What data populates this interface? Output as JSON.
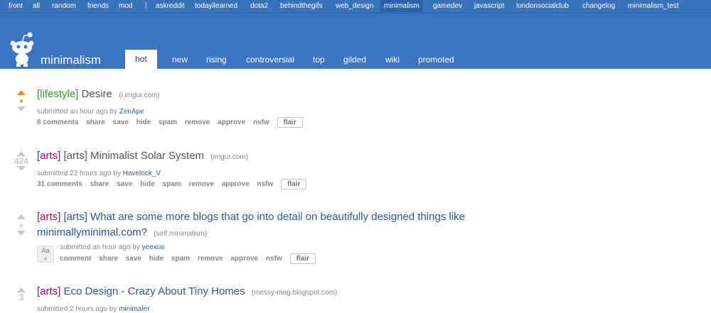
{
  "srbar": {
    "items": [
      "front",
      "all",
      "random",
      "friends",
      "mod",
      "|",
      "askreddit",
      "todayilearned",
      "dota2",
      "behindthegifs",
      "web_design",
      "minimalism",
      "gamedev",
      "javascript",
      "londonsocialclub",
      "changelog",
      "minimalism_test"
    ],
    "active": "minimalism"
  },
  "header": {
    "subreddit": "minimalism",
    "tabs": [
      "hot",
      "new",
      "rising",
      "controversial",
      "top",
      "gilded",
      "wiki",
      "promoted"
    ],
    "selected_tab": "hot"
  },
  "posts": [
    {
      "score": "",
      "flair": "[lifestyle]",
      "title": "Desire",
      "domain": "(i.imgur.com)",
      "submitted": "submitted an hour ago by",
      "author": "ZenApe",
      "buttons": [
        "8 comments",
        "share",
        "save",
        "hide",
        "spam",
        "remove",
        "approve",
        "nsfw"
      ],
      "flair_button": "flair"
    },
    {
      "score": "424",
      "flair": "[arts]",
      "title": "[arts] Minimalist Solar System",
      "domain": "(imgur.com)",
      "submitted": "submitted 22 hours ago by",
      "author": "Havelock_V",
      "buttons": [
        "31 comments",
        "share",
        "save",
        "hide",
        "spam",
        "remove",
        "approve",
        "nsfw"
      ],
      "flair_button": "flair"
    },
    {
      "score": "",
      "flair": "[arts]",
      "title_line1": "[arts] What are some more blogs that go into detail on beautifully designed things like",
      "title_line2": "minimallyminimal.com?",
      "domain": "(self.minimalism)",
      "thumb": "Aa",
      "submitted": "submitted an hour ago by",
      "author": "yeexus",
      "buttons": [
        "comment",
        "share",
        "save",
        "hide",
        "spam",
        "remove",
        "approve",
        "nsfw"
      ],
      "flair_button": "flair"
    },
    {
      "score": "3",
      "flair": "[arts]",
      "title": "Eco Design - Crazy About Tiny Homes",
      "domain": "(messy-mag.blogspot.com)",
      "submitted": "submitted 2 hours ago by",
      "author": "minimaler"
    }
  ]
}
